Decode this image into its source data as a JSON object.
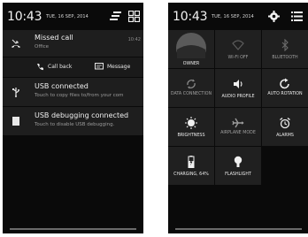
{
  "left": {
    "status": {
      "time": "10:43",
      "date": "TUE, 16 SEP, 2014"
    },
    "notifications": [
      {
        "title": "Missed call",
        "subtitle": "Office",
        "time": "10:42",
        "icon": "missed-call-icon"
      },
      {
        "title": "USB connected",
        "subtitle": "Touch to copy files to/from your com",
        "icon": "usb-icon"
      },
      {
        "title": "USB debugging connected",
        "subtitle": "Touch to disable USB debugging.",
        "icon": "usb-debugging-icon"
      }
    ],
    "actions": {
      "call_back": "Call back",
      "message": "Message"
    }
  },
  "right": {
    "status": {
      "time": "10:43",
      "date": "TUE, 16 SEP, 2014"
    },
    "tiles": [
      {
        "label": "OWNER"
      },
      {
        "label": "WI-FI OFF"
      },
      {
        "label": "BLUETOOTH"
      },
      {
        "label": "DATA CONNECTION"
      },
      {
        "label": "AUDIO PROFILE"
      },
      {
        "label": "AUTO ROTATION"
      },
      {
        "label": "BRIGHTNESS"
      },
      {
        "label": "AIRPLANE MODE"
      },
      {
        "label": "ALARMS"
      },
      {
        "label": "CHARGING, 64%",
        "level": 0.64
      },
      {
        "label": "FLASHLIGHT"
      }
    ]
  }
}
